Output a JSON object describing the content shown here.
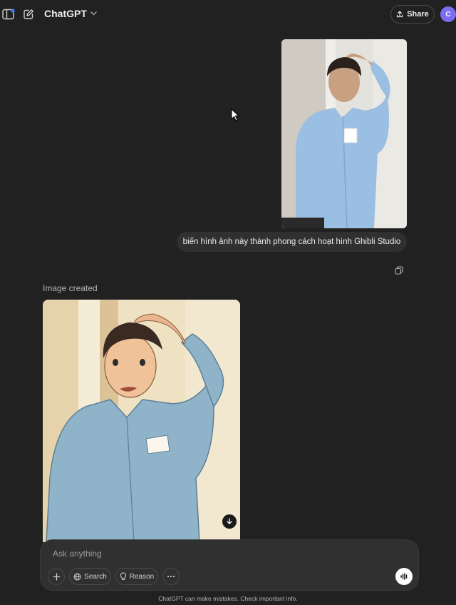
{
  "header": {
    "model_name": "ChatGPT",
    "share_label": "Share",
    "avatar_initial": "C"
  },
  "icons": {
    "sidebar_toggle": "sidebar-icon",
    "new_chat": "edit-icon",
    "model_menu": "chevron-down-icon",
    "share": "upload-icon",
    "copy": "copy-icon",
    "download": "download-icon",
    "attach": "plus-icon",
    "search": "globe-icon",
    "reason": "lightbulb-icon",
    "more": "ellipsis-icon",
    "voice": "voice-wave-icon"
  },
  "conversation": {
    "user_message": "biến hình ảnh này thành phong cách hoạt hình Ghibli Studio",
    "assistant_status": "Image created"
  },
  "composer": {
    "placeholder": "Ask anything",
    "search_label": "Search",
    "reason_label": "Reason"
  },
  "footer": {
    "disclaimer": "ChatGPT can make mistakes. Check important info."
  },
  "colors": {
    "background": "#212121",
    "bubble": "#303030",
    "avatar": "#7c6cf0",
    "text": "#ececec"
  }
}
